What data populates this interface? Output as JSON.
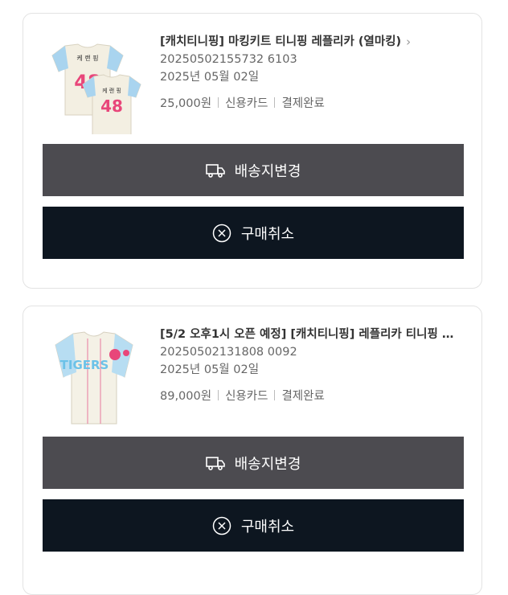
{
  "orders": [
    {
      "title": "[캐치티니핑] 마킹키트 티니핑 레플리카 (열마킹)",
      "order_no": "20250502155732 6103",
      "date": "2025년 05월 02일",
      "price": "25,000원",
      "payment": "신용카드",
      "status": "결제완료",
      "jersey_name": "케 랜 핑",
      "jersey_number": "48",
      "shipping_button": "배송지변경",
      "cancel_button": "구매취소"
    },
    {
      "title": "[5/2 오후1시 오픈 예정] [캐치티니핑] 레플리카 티니핑 …",
      "order_no": "20250502131808 0092",
      "date": "2025년 05월 02일",
      "price": "89,000원",
      "payment": "신용카드",
      "status": "결제완료",
      "jersey_text": "TIGERS",
      "shipping_button": "배송지변경",
      "cancel_button": "구매취소"
    }
  ],
  "icons": {
    "chevron": "chevron-right-icon",
    "truck": "truck-icon",
    "cancel": "close-circle-icon"
  }
}
